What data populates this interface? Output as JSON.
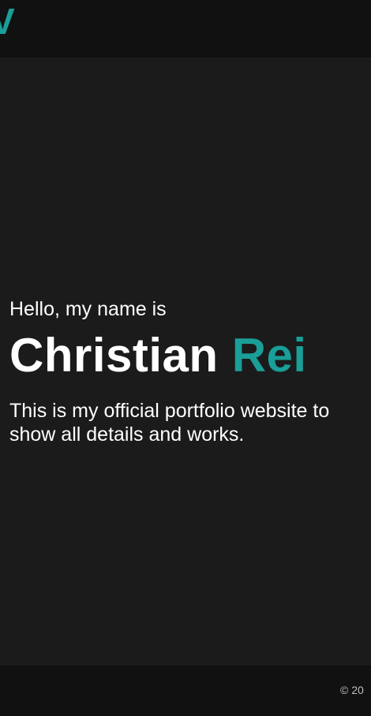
{
  "header": {
    "logo_text": "V"
  },
  "hero": {
    "greeting": "Hello, my name is",
    "first_name": "Christian",
    "last_name": "Rei",
    "tagline": "This is my official portfolio website to show all details and works."
  },
  "footer": {
    "copyright": "© 20"
  },
  "colors": {
    "accent": "#1a9e98",
    "background": "#1b1b1b",
    "header_footer_bg": "#111111",
    "text": "#ffffff"
  }
}
